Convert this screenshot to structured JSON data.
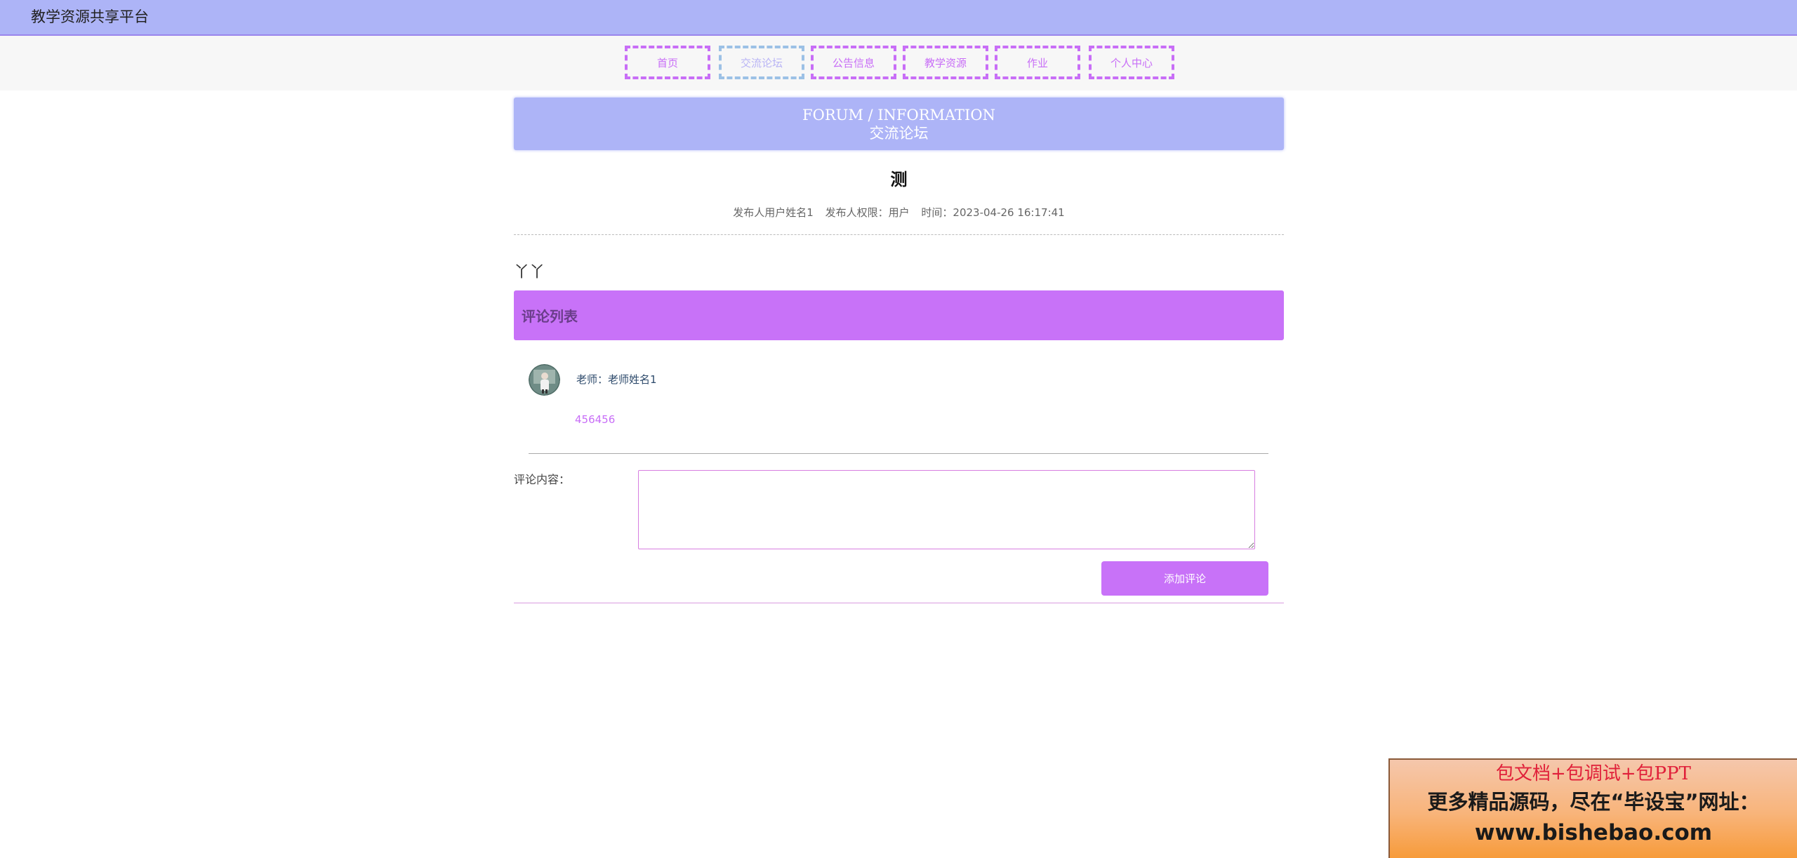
{
  "header": {
    "site_title": "教学资源共享平台"
  },
  "nav": {
    "items": [
      {
        "label": "首页",
        "active": false
      },
      {
        "label": "交流论坛",
        "active": true
      },
      {
        "label": "公告信息",
        "active": false
      },
      {
        "label": "教学资源",
        "active": false
      },
      {
        "label": "作业",
        "active": false
      },
      {
        "label": "个人中心",
        "active": false
      }
    ]
  },
  "banner": {
    "en": "FORUM / INFORMATION",
    "cn": "交流论坛"
  },
  "post": {
    "title": "测",
    "author_label": "发布人用户姓名1",
    "role_label": "发布人权限：用户",
    "time_label": "时间：2023-04-26 16:17:41",
    "body": "丫丫"
  },
  "comments": {
    "header": "评论列表",
    "items": [
      {
        "author": "老师：老师姓名1",
        "content": "456456"
      }
    ]
  },
  "comment_form": {
    "label": "评论内容：",
    "textarea_value": "",
    "submit_label": "添加评论"
  },
  "watermark": {
    "line1": "包文档+包调试+包PPT",
    "line2": "更多精品源码，尽在“毕设宝”网址：",
    "line3": "www.bishebao.com"
  },
  "colors": {
    "topbar": "#adb4f7",
    "accent": "#c872f8",
    "nav_active_border": "#9cc1e6"
  }
}
